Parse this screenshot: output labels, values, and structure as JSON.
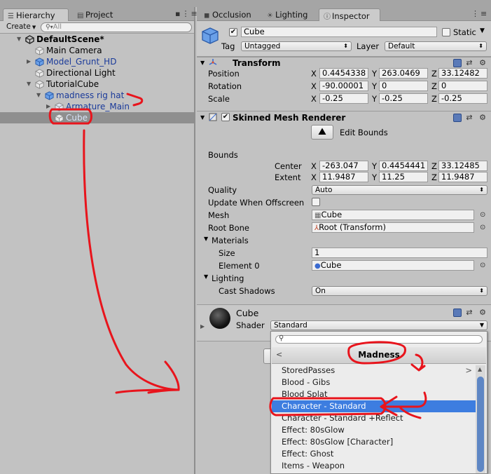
{
  "hierarchy": {
    "tab_label": "Hierarchy",
    "project_tab_label": "Project",
    "create_label": "Create",
    "search_placeholder": "All",
    "items": [
      {
        "label": "DefaultScene*"
      },
      {
        "label": "Main Camera"
      },
      {
        "label": "Model_Grunt_HD"
      },
      {
        "label": "Directional Light"
      },
      {
        "label": "TutorialCube"
      },
      {
        "label": "madness rig hat"
      },
      {
        "label": "Armature_Main"
      },
      {
        "label": "Cube"
      }
    ]
  },
  "inspector": {
    "tabs": [
      {
        "label": "Occlusion"
      },
      {
        "label": "Lighting"
      },
      {
        "label": "Inspector"
      }
    ],
    "object": {
      "name": "Cube",
      "static_label": "Static",
      "tag_label": "Tag",
      "tag_value": "Untagged",
      "layer_label": "Layer",
      "layer_value": "Default"
    },
    "transform": {
      "title": "Transform",
      "position_label": "Position",
      "rotation_label": "Rotation",
      "scale_label": "Scale",
      "position": {
        "x": "0.4454338",
        "y": "263.0469",
        "z": "33.12482"
      },
      "rotation": {
        "x": "-90.00001",
        "y": "0",
        "z": "0"
      },
      "scale": {
        "x": "-0.25",
        "y": "-0.25",
        "z": "-0.25"
      }
    },
    "smr": {
      "title": "Skinned Mesh Renderer",
      "edit_bounds_label": "Edit Bounds",
      "bounds_label": "Bounds",
      "center_label": "Center",
      "extent_label": "Extent",
      "center": {
        "x": "-263.047",
        "y": "0.4454441",
        "z": "33.12485"
      },
      "extent": {
        "x": "11.9487",
        "y": "11.25",
        "z": "11.9487"
      },
      "quality_label": "Quality",
      "quality_value": "Auto",
      "update_offscreen_label": "Update When Offscreen",
      "mesh_label": "Mesh",
      "mesh_value": "Cube",
      "root_bone_label": "Root Bone",
      "root_bone_value": "Root (Transform)",
      "materials_label": "Materials",
      "size_label": "Size",
      "size_value": "1",
      "element0_label": "Element 0",
      "element0_value": "Cube",
      "lighting_label": "Lighting",
      "cast_shadows_label": "Cast Shadows",
      "cast_shadows_value": "On"
    },
    "material": {
      "name": "Cube",
      "shader_label": "Shader",
      "shader_value": "Standard"
    }
  },
  "shader_popup": {
    "title": "Madness",
    "items": [
      {
        "label": "StoredPasses",
        "submenu": true
      },
      {
        "label": "Blood - Gibs"
      },
      {
        "label": "Blood Splat"
      },
      {
        "label": "Character - Standard",
        "highlighted": true
      },
      {
        "label": "Character - Standard +Reflect"
      },
      {
        "label": "Effect: 80sGlow"
      },
      {
        "label": "Effect: 80sGlow [Character]"
      },
      {
        "label": "Effect: Ghost"
      },
      {
        "label": "Items - Weapon"
      }
    ]
  },
  "colors": {
    "highlight": "#3d7de0",
    "annotation": "#e8141c",
    "prefab_text": "#1a3a9a"
  },
  "icons": [
    "hierarchy-icon",
    "project-icon",
    "unity-scene-icon",
    "gameobject-icon",
    "prefab-icon",
    "transform-icon",
    "skinned-mesh-icon",
    "edit-bounds-icon",
    "mesh-icon",
    "bone-icon",
    "material-sphere-icon",
    "book-help-icon",
    "settings-gear-icon",
    "search-icon",
    "chevron-left-icon",
    "chevron-right-icon"
  ]
}
